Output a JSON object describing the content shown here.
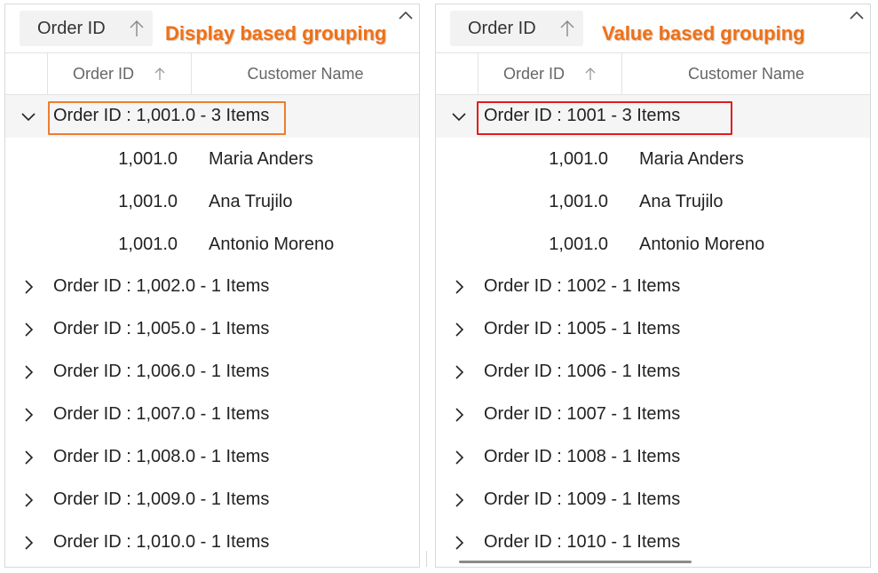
{
  "left": {
    "group_chip_label": "Order ID",
    "callout": "Display based grouping",
    "header": {
      "order_id": "Order ID",
      "customer_name": "Customer Name"
    },
    "expanded_group": {
      "caption": "Order ID : 1,001.0 - 3 Items",
      "rows": [
        {
          "order_id": "1,001.0",
          "customer": "Maria Anders"
        },
        {
          "order_id": "1,001.0",
          "customer": "Ana Trujilo"
        },
        {
          "order_id": "1,001.0",
          "customer": "Antonio Moreno"
        }
      ]
    },
    "collapsed_groups": [
      "Order ID : 1,002.0 - 1 Items",
      "Order ID : 1,005.0 - 1 Items",
      "Order ID : 1,006.0 - 1 Items",
      "Order ID : 1,007.0 - 1 Items",
      "Order ID : 1,008.0 - 1 Items",
      "Order ID : 1,009.0 - 1 Items",
      "Order ID : 1,010.0 - 1 Items"
    ],
    "highlight_color": "#ed7d31"
  },
  "right": {
    "group_chip_label": "Order ID",
    "callout": "Value based grouping",
    "header": {
      "order_id": "Order ID",
      "customer_name": "Customer Name"
    },
    "expanded_group": {
      "caption": "Order ID : 1001 - 3 Items",
      "rows": [
        {
          "order_id": "1,001.0",
          "customer": "Maria Anders"
        },
        {
          "order_id": "1,001.0",
          "customer": "Ana Trujilo"
        },
        {
          "order_id": "1,001.0",
          "customer": "Antonio Moreno"
        }
      ]
    },
    "collapsed_groups": [
      "Order ID : 1002 - 1 Items",
      "Order ID : 1005 - 1 Items",
      "Order ID : 1006 - 1 Items",
      "Order ID : 1007 - 1 Items",
      "Order ID : 1008 - 1 Items",
      "Order ID : 1009 - 1 Items",
      "Order ID : 1010 - 1 Items"
    ],
    "highlight_color": "#e21d1d"
  },
  "callout_color": "#f07016",
  "icons": {
    "sort": "arrow-up-icon",
    "collapse_panel": "chevron-up-icon",
    "expanded": "chevron-down-icon",
    "collapsed": "chevron-right-icon"
  }
}
